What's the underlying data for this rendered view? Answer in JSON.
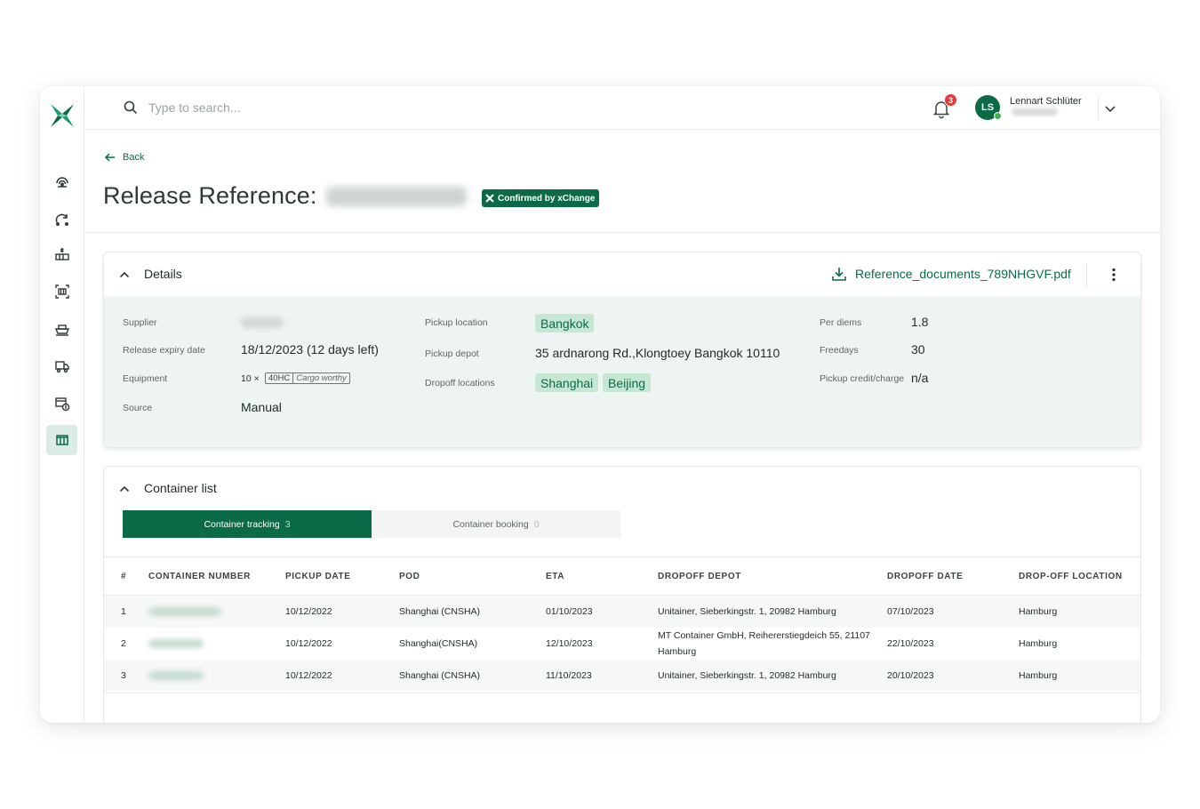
{
  "search": {
    "placeholder": "Type to search..."
  },
  "notifications": {
    "count": "3"
  },
  "user": {
    "initials": "LS",
    "name": "Lennart Schlüter"
  },
  "header": {
    "back_label": "Back",
    "title": "Release Reference:",
    "badge": "Confirmed by xChange"
  },
  "details": {
    "title": "Details",
    "document": "Reference_documents_789NHGVF.pdf",
    "fields": {
      "supplier_label": "Supplier",
      "release_expiry_label": "Release expiry date",
      "release_expiry_value": "18/12/2023 (12 days left)",
      "equipment_label": "Equipment",
      "equipment_count": "10 ×",
      "equipment_code": "40HC",
      "equipment_desc": "Cargo worthy",
      "source_label": "Source",
      "source_value": "Manual",
      "pickup_location_label": "Pickup location",
      "pickup_location_value": "Bangkok",
      "pickup_depot_label": "Pickup depot",
      "pickup_depot_value": "35 ardnarong Rd.,Klongtoey Bangkok 10110",
      "dropoff_locations_label": "Dropoff locations",
      "dropoff_locations": [
        "Shanghai",
        "Beijing"
      ],
      "per_diems_label": "Per diems",
      "per_diems_value": "1.8",
      "freedays_label": "Freedays",
      "freedays_value": "30",
      "pickup_credit_label": "Pickup credit/charge",
      "pickup_credit_value": "n/a"
    }
  },
  "container_list": {
    "title": "Container list",
    "tabs": [
      {
        "label": "Container tracking",
        "count": "3"
      },
      {
        "label": "Container booking",
        "count": "0"
      }
    ],
    "columns": [
      "#",
      "CONTAINER NUMBER",
      "PICKUP DATE",
      "POD",
      "ETA",
      "DROPOFF DEPOT",
      "DROPOFF DATE",
      "DROP-OFF LOCATION"
    ],
    "rows": [
      {
        "index": "1",
        "pickup_date": "10/12/2022",
        "pod": "Shanghai (CNSHA)",
        "eta": "01/10/2023",
        "depot_line1": "Unitainer, Sieberkingstr. 1, 20982 Hamburg",
        "depot_line2": "",
        "dropoff_date": "07/10/2023",
        "location": "Hamburg"
      },
      {
        "index": "2",
        "pickup_date": "10/12/2022",
        "pod": "Shanghai(CNSHA)",
        "eta": "12/10/2023",
        "depot_line1": "MT Container GmbH, Reihererstiegdeich 55, 21107",
        "depot_line2": "Hamburg",
        "dropoff_date": "22/10/2023",
        "location": "Hamburg"
      },
      {
        "index": "3",
        "pickup_date": "10/12/2022",
        "pod": "Shanghai (CNSHA)",
        "eta": "11/10/2023",
        "depot_line1": "Unitainer, Sieberkingstr. 1, 20982 Hamburg",
        "depot_line2": "",
        "dropoff_date": "20/10/2023",
        "location": "Hamburg"
      }
    ]
  },
  "colors": {
    "brand": "#0b6b46",
    "chip_bg": "#c7e7d5",
    "details_bg": "#eef4f1",
    "badge_red": "#e53935"
  },
  "icons": [
    "xchange-logo-icon",
    "search-icon",
    "bell-icon",
    "chevron-down-icon",
    "arrow-left-icon",
    "download-icon",
    "kebab-icon",
    "chevron-up-icon"
  ]
}
